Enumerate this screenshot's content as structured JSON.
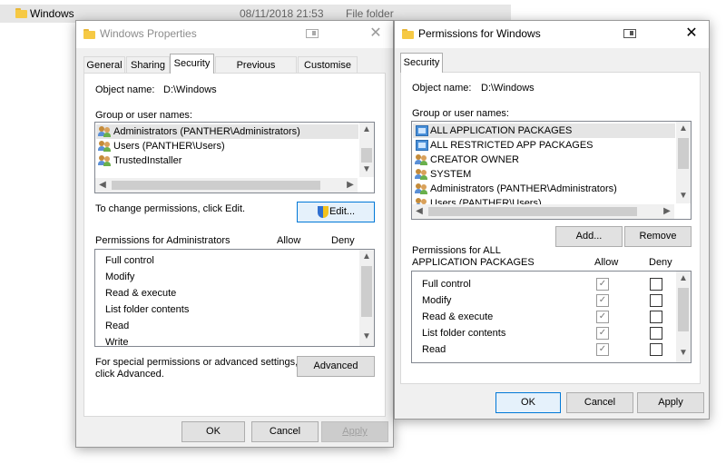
{
  "explorer_row": {
    "name": "Windows",
    "date": "08/11/2018 21:53",
    "type": "File folder"
  },
  "props_window": {
    "title": "Windows Properties",
    "tabs": [
      "General",
      "Sharing",
      "Security",
      "Previous Versions",
      "Customise"
    ],
    "active_tab": "Security",
    "object_name_label": "Object name:",
    "object_name_value": "D:\\Windows",
    "group_label": "Group or user names:",
    "groups": [
      "Administrators (PANTHER\\Administrators)",
      "Users (PANTHER\\Users)",
      "TrustedInstaller"
    ],
    "change_text": "To change permissions, click Edit.",
    "edit_button": "Edit...",
    "perm_header": "Permissions for Administrators",
    "allow_header": "Allow",
    "deny_header": "Deny",
    "permissions": [
      "Full control",
      "Modify",
      "Read & execute",
      "List folder contents",
      "Read",
      "Write"
    ],
    "special_text_1": "For special permissions or advanced settings,",
    "special_text_2": "click Advanced.",
    "advanced_button": "Advanced",
    "ok_button": "OK",
    "cancel_button": "Cancel",
    "apply_button": "Apply"
  },
  "perm_window": {
    "title": "Permissions for Windows",
    "tab": "Security",
    "object_name_label": "Object name:",
    "object_name_value": "D:\\Windows",
    "group_label": "Group or user names:",
    "groups": [
      {
        "name": "ALL APPLICATION PACKAGES",
        "icon": "package-icon"
      },
      {
        "name": "ALL RESTRICTED APP PACKAGES",
        "icon": "package-icon"
      },
      {
        "name": "CREATOR OWNER",
        "icon": "users-icon"
      },
      {
        "name": "SYSTEM",
        "icon": "users-icon"
      },
      {
        "name": "Administrators (PANTHER\\Administrators)",
        "icon": "users-icon"
      },
      {
        "name": "Users (PANTHER\\Users)",
        "icon": "users-icon"
      }
    ],
    "add_button": "Add...",
    "remove_button": "Remove",
    "perm_header_1": "Permissions for ALL",
    "perm_header_2": "APPLICATION PACKAGES",
    "allow_header": "Allow",
    "deny_header": "Deny",
    "permissions": [
      {
        "name": "Full control",
        "allow": false,
        "deny": false
      },
      {
        "name": "Modify",
        "allow": false,
        "deny": false
      },
      {
        "name": "Read & execute",
        "allow": true,
        "deny": false
      },
      {
        "name": "List folder contents",
        "allow": true,
        "deny": false
      },
      {
        "name": "Read",
        "allow": true,
        "deny": false
      }
    ],
    "ok_button": "OK",
    "cancel_button": "Cancel",
    "apply_button": "Apply"
  },
  "icons": {
    "close": "close-icon",
    "restore": "restore-icon",
    "folder": "folder-icon",
    "shield": "uac-shield-icon"
  },
  "colors": {
    "selection": "#e5e5e5",
    "default_button_border": "#0078d7",
    "window_bg": "#f0f0f0"
  }
}
